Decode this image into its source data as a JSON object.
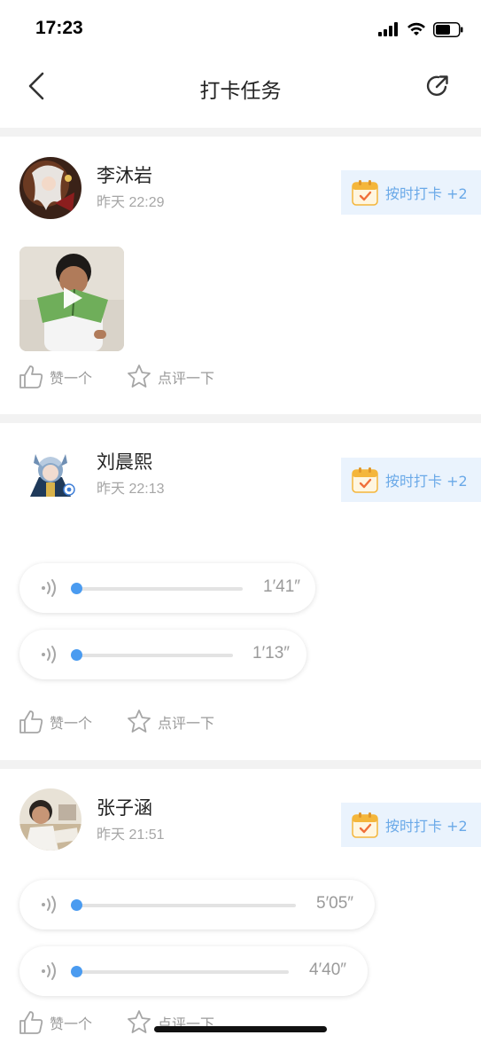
{
  "status_bar": {
    "time": "17:23"
  },
  "nav": {
    "title": "打卡任务"
  },
  "posts": [
    {
      "user": "李沐岩",
      "time": "昨天 22:29",
      "badge": "按时打卡 +2",
      "media": "video",
      "like_label": "赞一个",
      "comment_label": "点评一下"
    },
    {
      "user": "刘晨熙",
      "time": "昨天 22:13",
      "badge": "按时打卡 +2",
      "audios": [
        {
          "duration": "1′41″"
        },
        {
          "duration": "1′13″"
        }
      ],
      "like_label": "赞一个",
      "comment_label": "点评一下"
    },
    {
      "user": "张子涵",
      "time": "昨天 21:51",
      "badge": "按时打卡 +2",
      "audios": [
        {
          "duration": "5′05″"
        },
        {
          "duration": "4′40″"
        }
      ],
      "like_label": "赞一个",
      "comment_label": "点评一下"
    }
  ],
  "icons": {
    "back": "chevron-left-icon",
    "share": "share-icon",
    "calendar": "calendar-check-icon",
    "like": "thumbs-up-icon",
    "comment": "star-comment-icon",
    "audio": "sound-wave-icon",
    "play": "play-icon"
  },
  "colors": {
    "accent": "#4a9bf0",
    "badge_bg": "#eaf3fd",
    "badge_text": "#6aa9e8",
    "muted": "#9a9a9a"
  }
}
